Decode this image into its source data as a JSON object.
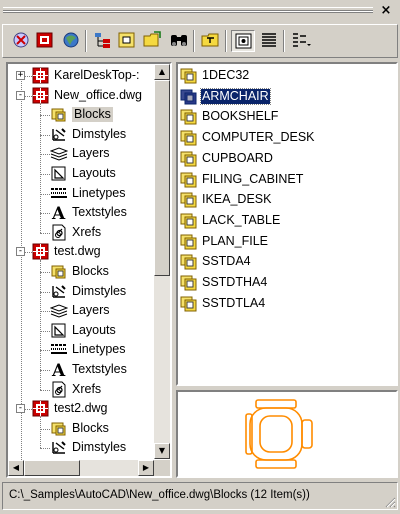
{
  "window": {
    "close_glyph": "×"
  },
  "toolbar": {
    "buttons": [
      {
        "name": "tree-toggle-icon"
      },
      {
        "name": "favorites-icon"
      },
      {
        "name": "load-icon"
      },
      {
        "name": "tree-view-icon"
      },
      {
        "name": "preview-icon"
      },
      {
        "name": "open-folder-icon"
      },
      {
        "name": "binoculars-icon"
      },
      {
        "name": "up-folder-icon"
      },
      {
        "name": "preview-toggle-icon"
      },
      {
        "name": "description-icon"
      },
      {
        "name": "views-icon"
      }
    ]
  },
  "tree": {
    "items": [
      {
        "label": "KarelDeskTop-:",
        "type": "drawing",
        "level": 0,
        "expander": "+"
      },
      {
        "label": "New_office.dwg",
        "type": "drawing",
        "level": 0,
        "expander": "-"
      },
      {
        "label": "Blocks",
        "type": "blocks",
        "level": 1,
        "selected": true
      },
      {
        "label": "Dimstyles",
        "type": "dimstyles",
        "level": 1
      },
      {
        "label": "Layers",
        "type": "layers",
        "level": 1
      },
      {
        "label": "Layouts",
        "type": "layouts",
        "level": 1
      },
      {
        "label": "Linetypes",
        "type": "linetypes",
        "level": 1
      },
      {
        "label": "Textstyles",
        "type": "textstyles",
        "level": 1
      },
      {
        "label": "Xrefs",
        "type": "xrefs",
        "level": 1
      },
      {
        "label": "test.dwg",
        "type": "drawing",
        "level": 0,
        "expander": "-"
      },
      {
        "label": "Blocks",
        "type": "blocks",
        "level": 1
      },
      {
        "label": "Dimstyles",
        "type": "dimstyles",
        "level": 1
      },
      {
        "label": "Layers",
        "type": "layers",
        "level": 1
      },
      {
        "label": "Layouts",
        "type": "layouts",
        "level": 1
      },
      {
        "label": "Linetypes",
        "type": "linetypes",
        "level": 1
      },
      {
        "label": "Textstyles",
        "type": "textstyles",
        "level": 1
      },
      {
        "label": "Xrefs",
        "type": "xrefs",
        "level": 1
      },
      {
        "label": "test2.dwg",
        "type": "drawing",
        "level": 0,
        "expander": "-"
      },
      {
        "label": "Blocks",
        "type": "blocks",
        "level": 1
      },
      {
        "label": "Dimstyles",
        "type": "dimstyles",
        "level": 1
      }
    ],
    "scroll_up_glyph": "▲",
    "scroll_down_glyph": "▼",
    "scroll_left_glyph": "◀",
    "scroll_right_glyph": "▶"
  },
  "list": {
    "items": [
      {
        "name": "1DEC32"
      },
      {
        "name": "ARMCHAIR",
        "selected": true
      },
      {
        "name": "BOOKSHELF"
      },
      {
        "name": "COMPUTER_DESK"
      },
      {
        "name": "CUPBOARD"
      },
      {
        "name": "FILING_CABINET"
      },
      {
        "name": "IKEA_DESK"
      },
      {
        "name": "LACK_TABLE"
      },
      {
        "name": "PLAN_FILE"
      },
      {
        "name": "SSTDA4"
      },
      {
        "name": "SSTDTHA4"
      },
      {
        "name": "SSTDTLA4"
      }
    ]
  },
  "status": {
    "text": "C:\\_Samples\\AutoCAD\\New_office.dwg\\Blocks (12 Item(s))"
  },
  "colors": {
    "selection": "#0a246a",
    "preview_stroke": "#ff8c00",
    "dwg_red": "#cc0000"
  }
}
